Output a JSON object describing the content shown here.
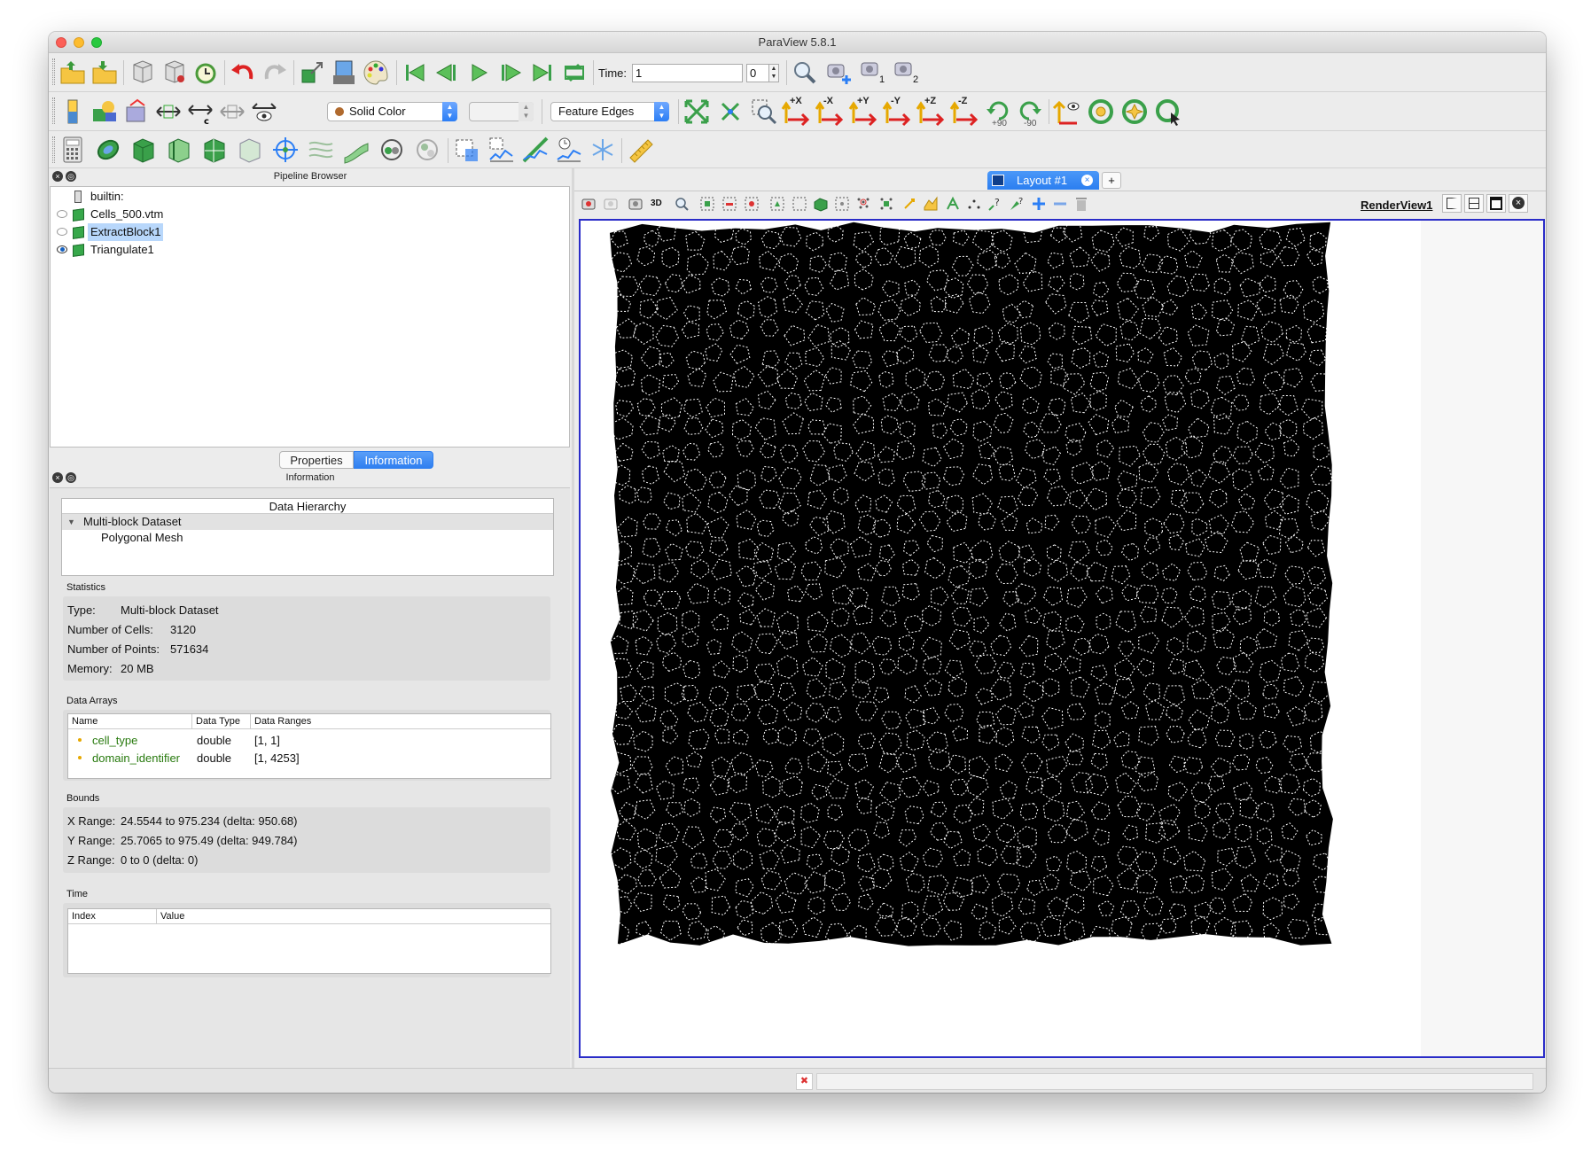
{
  "app": {
    "title": "ParaView 5.8.1"
  },
  "toolbar": {
    "time_label": "Time:",
    "time_value": "1",
    "time_index": "0",
    "color_mode": "Solid Color",
    "component": "",
    "representation": "Feature Edges",
    "rotate_plus": "+90",
    "rotate_minus": "-90",
    "axis_labels": [
      "+X",
      "-X",
      "+Y",
      "-Y",
      "+Z",
      "-Z"
    ],
    "camera_labels": [
      "1",
      "2"
    ]
  },
  "pipeline": {
    "title": "Pipeline Browser",
    "items": [
      {
        "label": "builtin:"
      },
      {
        "label": "Cells_500.vtm"
      },
      {
        "label": "ExtractBlock1"
      },
      {
        "label": "Triangulate1"
      }
    ]
  },
  "tabs": {
    "properties": "Properties",
    "information": "Information"
  },
  "info": {
    "title": "Information",
    "hierarchy_title": "Data Hierarchy",
    "hierarchy_root": "Multi-block Dataset",
    "hierarchy_child": "Polygonal Mesh",
    "statistics_label": "Statistics",
    "type_label": "Type:",
    "type_value": "Multi-block Dataset",
    "cells_label": "Number of Cells:",
    "cells_value": "3120",
    "points_label": "Number of Points:",
    "points_value": "571634",
    "memory_label": "Memory:",
    "memory_value": "20 MB",
    "arrays_label": "Data Arrays",
    "arrays_headers": [
      "Name",
      "Data Type",
      "Data Ranges"
    ],
    "arrays": [
      {
        "name": "cell_type",
        "type": "double",
        "range": "[1, 1]"
      },
      {
        "name": "domain_identifier",
        "type": "double",
        "range": "[1, 4253]"
      }
    ],
    "bounds_label": "Bounds",
    "x_range_label": "X Range:",
    "x_range": "24.5544 to 975.234 (delta: 950.68)",
    "y_range_label": "Y Range:",
    "y_range": "25.7065 to 975.49 (delta: 949.784)",
    "z_range_label": "Z Range:",
    "z_range": "0 to 0 (delta: 0)",
    "time_label": "Time",
    "time_headers": [
      "Index",
      "Value"
    ]
  },
  "layout": {
    "tab_label": "Layout #1",
    "add_label": "+",
    "view_name": "RenderView1",
    "mode_3d": "3D"
  },
  "colors": {
    "accent": "#2b7ef5",
    "view_border": "#2a2cc8",
    "selection": "#b8d7fb",
    "array_name": "#287a0e",
    "mesh": "#000000"
  }
}
